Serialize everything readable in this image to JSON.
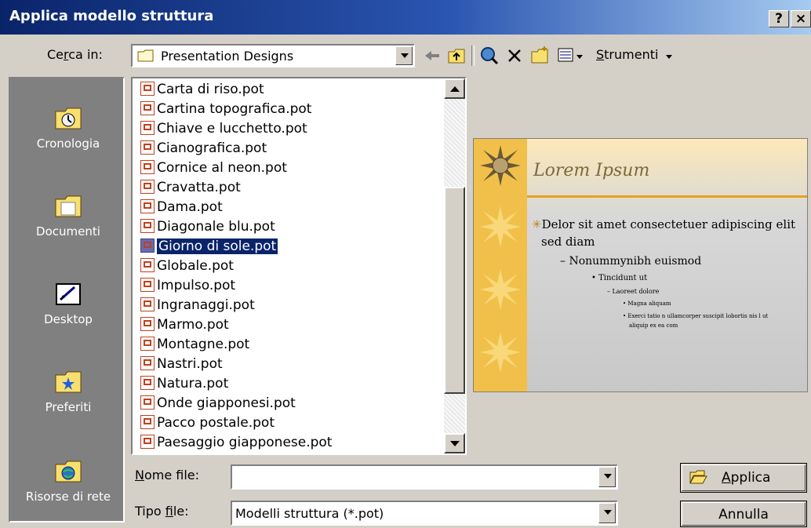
{
  "window": {
    "title": "Applica modello struttura",
    "help_label": "?",
    "close_label": "×"
  },
  "look_in": {
    "label_pre": "Ce",
    "label_key": "r",
    "label_post": "ca in:",
    "value": "Presentation Designs"
  },
  "toolbar": {
    "tools_label": "Strumenti",
    "tools_key": "S",
    "tools_rest": "trumenti"
  },
  "places": [
    {
      "label": "Cronologia"
    },
    {
      "label": "Documenti"
    },
    {
      "label": "Desktop"
    },
    {
      "label": "Preferiti"
    },
    {
      "label": "Risorse di rete"
    }
  ],
  "files": [
    "Carta di riso.pot",
    "Cartina topografica.pot",
    "Chiave e lucchetto.pot",
    "Cianografica.pot",
    "Cornice al neon.pot",
    "Cravatta.pot",
    "Dama.pot",
    "Diagonale blu.pot",
    "Giorno di sole.pot",
    "Globale.pot",
    "Impulso.pot",
    "Ingranaggi.pot",
    "Marmo.pot",
    "Montagne.pot",
    "Nastri.pot",
    "Natura.pot",
    "Onde giapponesi.pot",
    "Pacco postale.pot",
    "Paesaggio giapponese.pot"
  ],
  "selected_file": "Giorno di sole.pot",
  "preview": {
    "title": "Lorem Ipsum",
    "l1a": "Delor sit amet consectetuer adipiscing elit",
    "l1b": "sed diam",
    "l2": "– Nonummynibh euismod",
    "l3": "• Tincidunt ut",
    "l4": "– Laoreet dolore",
    "l5": "• Magna aliquam",
    "l6a": "• Exerci tatio n ullamcorper suscipit lobortis nis l ut",
    "l6b": "aliquip ex ea com"
  },
  "filename": {
    "label_key": "N",
    "label_rest": "ome file:",
    "value": ""
  },
  "filetype": {
    "label_pre": "Tipo ",
    "label_key": "f",
    "label_rest": "ile:",
    "value": "Modelli struttura (*.pot)"
  },
  "buttons": {
    "apply_key": "A",
    "apply_rest": "pplica",
    "cancel": "Annulla"
  },
  "colors": {
    "titlebar_start": "#0a246a",
    "selection": "#0a246a",
    "dialog_bg": "#d4d0c8",
    "places_bg": "#808080"
  }
}
